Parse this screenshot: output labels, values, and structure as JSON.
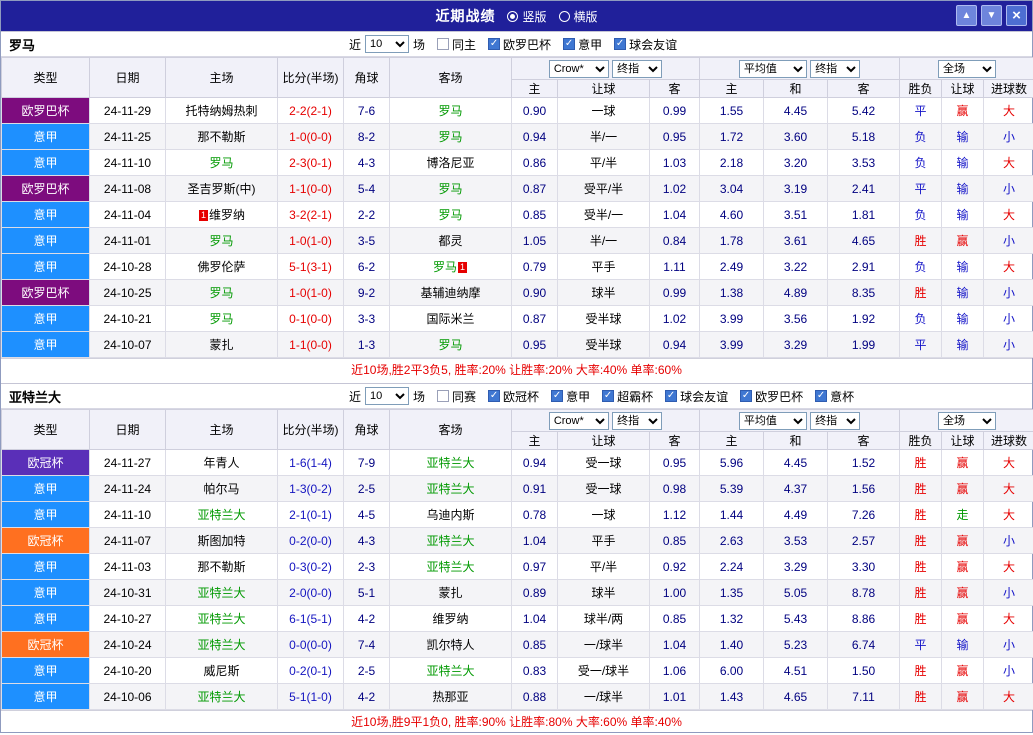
{
  "titlebar": {
    "title": "近期战绩",
    "radios": [
      {
        "label": "竖版",
        "selected": true
      },
      {
        "label": "横版",
        "selected": false
      }
    ],
    "buttons": {
      "up": "▲",
      "down": "▼",
      "close": "×"
    }
  },
  "columns": {
    "main": [
      "类型",
      "日期",
      "主场",
      "比分(半场)",
      "角球",
      "客场"
    ],
    "sub": [
      "主",
      "让球",
      "客",
      "主",
      "和",
      "客",
      "胜负",
      "让球",
      "进球数"
    ]
  },
  "colors": {
    "r": "#e60000",
    "b": "#1414c8",
    "g": "#009900"
  },
  "sections": [
    {
      "team": "罗马",
      "score_color": "#e60000",
      "filter": {
        "prefix": "近",
        "count": "10",
        "suffix": "场",
        "checkboxes": [
          {
            "label": "同主",
            "checked": false
          },
          {
            "label": "欧罗巴杯",
            "checked": true
          },
          {
            "label": "意甲",
            "checked": true
          },
          {
            "label": "球会友谊",
            "checked": true
          }
        ]
      },
      "selects": {
        "asia_company": "Crow*",
        "asia_time": "终指",
        "euro_company": "平均值",
        "euro_time": "终指",
        "scope": "全场"
      },
      "rows": [
        {
          "type": "欧罗巴杯",
          "type_color": "#7d0c7e",
          "date": "24-11-29",
          "home": "托特纳姆热刺",
          "home_focus": false,
          "home_badge": "",
          "score": "2-2(2-1)",
          "corner": "7-6",
          "away": "罗马",
          "away_focus": true,
          "away_badge": "",
          "asia": [
            "0.90",
            "一球",
            "0.99"
          ],
          "euro": [
            "1.55",
            "4.45",
            "5.42"
          ],
          "result": "平",
          "result_c": "b",
          "hcap": "赢",
          "hcap_c": "r",
          "goal": "大",
          "goal_c": "r"
        },
        {
          "type": "意甲",
          "type_color": "#1e90ff",
          "date": "24-11-25",
          "home": "那不勒斯",
          "home_focus": false,
          "home_badge": "",
          "score": "1-0(0-0)",
          "corner": "8-2",
          "away": "罗马",
          "away_focus": true,
          "away_badge": "",
          "asia": [
            "0.94",
            "半/一",
            "0.95"
          ],
          "euro": [
            "1.72",
            "3.60",
            "5.18"
          ],
          "result": "负",
          "result_c": "b",
          "hcap": "输",
          "hcap_c": "b",
          "goal": "小",
          "goal_c": "b"
        },
        {
          "type": "意甲",
          "type_color": "#1e90ff",
          "date": "24-11-10",
          "home": "罗马",
          "home_focus": true,
          "home_badge": "",
          "score": "2-3(0-1)",
          "corner": "4-3",
          "away": "博洛尼亚",
          "away_focus": false,
          "away_badge": "",
          "asia": [
            "0.86",
            "平/半",
            "1.03"
          ],
          "euro": [
            "2.18",
            "3.20",
            "3.53"
          ],
          "result": "负",
          "result_c": "b",
          "hcap": "输",
          "hcap_c": "b",
          "goal": "大",
          "goal_c": "r"
        },
        {
          "type": "欧罗巴杯",
          "type_color": "#7d0c7e",
          "date": "24-11-08",
          "home": "圣吉罗斯(中)",
          "home_focus": false,
          "home_badge": "",
          "score": "1-1(0-0)",
          "corner": "5-4",
          "away": "罗马",
          "away_focus": true,
          "away_badge": "",
          "asia": [
            "0.87",
            "受平/半",
            "1.02"
          ],
          "euro": [
            "3.04",
            "3.19",
            "2.41"
          ],
          "result": "平",
          "result_c": "b",
          "hcap": "输",
          "hcap_c": "b",
          "goal": "小",
          "goal_c": "b"
        },
        {
          "type": "意甲",
          "type_color": "#1e90ff",
          "date": "24-11-04",
          "home": "维罗纳",
          "home_focus": false,
          "home_badge": "1",
          "score": "3-2(2-1)",
          "corner": "2-2",
          "away": "罗马",
          "away_focus": true,
          "away_badge": "",
          "asia": [
            "0.85",
            "受半/一",
            "1.04"
          ],
          "euro": [
            "4.60",
            "3.51",
            "1.81"
          ],
          "result": "负",
          "result_c": "b",
          "hcap": "输",
          "hcap_c": "b",
          "goal": "大",
          "goal_c": "r"
        },
        {
          "type": "意甲",
          "type_color": "#1e90ff",
          "date": "24-11-01",
          "home": "罗马",
          "home_focus": true,
          "home_badge": "",
          "score": "1-0(1-0)",
          "corner": "3-5",
          "away": "都灵",
          "away_focus": false,
          "away_badge": "",
          "asia": [
            "1.05",
            "半/一",
            "0.84"
          ],
          "euro": [
            "1.78",
            "3.61",
            "4.65"
          ],
          "result": "胜",
          "result_c": "r",
          "hcap": "赢",
          "hcap_c": "r",
          "goal": "小",
          "goal_c": "b"
        },
        {
          "type": "意甲",
          "type_color": "#1e90ff",
          "date": "24-10-28",
          "home": "佛罗伦萨",
          "home_focus": false,
          "home_badge": "",
          "score": "5-1(3-1)",
          "corner": "6-2",
          "away": "罗马",
          "away_focus": true,
          "away_badge": "1",
          "asia": [
            "0.79",
            "平手",
            "1.11"
          ],
          "euro": [
            "2.49",
            "3.22",
            "2.91"
          ],
          "result": "负",
          "result_c": "b",
          "hcap": "输",
          "hcap_c": "b",
          "goal": "大",
          "goal_c": "r"
        },
        {
          "type": "欧罗巴杯",
          "type_color": "#7d0c7e",
          "date": "24-10-25",
          "home": "罗马",
          "home_focus": true,
          "home_badge": "",
          "score": "1-0(1-0)",
          "corner": "9-2",
          "away": "基辅迪纳摩",
          "away_focus": false,
          "away_badge": "",
          "asia": [
            "0.90",
            "球半",
            "0.99"
          ],
          "euro": [
            "1.38",
            "4.89",
            "8.35"
          ],
          "result": "胜",
          "result_c": "r",
          "hcap": "输",
          "hcap_c": "b",
          "goal": "小",
          "goal_c": "b"
        },
        {
          "type": "意甲",
          "type_color": "#1e90ff",
          "date": "24-10-21",
          "home": "罗马",
          "home_focus": true,
          "home_badge": "",
          "score": "0-1(0-0)",
          "corner": "3-3",
          "away": "国际米兰",
          "away_focus": false,
          "away_badge": "",
          "asia": [
            "0.87",
            "受半球",
            "1.02"
          ],
          "euro": [
            "3.99",
            "3.56",
            "1.92"
          ],
          "result": "负",
          "result_c": "b",
          "hcap": "输",
          "hcap_c": "b",
          "goal": "小",
          "goal_c": "b"
        },
        {
          "type": "意甲",
          "type_color": "#1e90ff",
          "date": "24-10-07",
          "home": "蒙扎",
          "home_focus": false,
          "home_badge": "",
          "score": "1-1(0-0)",
          "corner": "1-3",
          "away": "罗马",
          "away_focus": true,
          "away_badge": "",
          "asia": [
            "0.95",
            "受半球",
            "0.94"
          ],
          "euro": [
            "3.99",
            "3.29",
            "1.99"
          ],
          "result": "平",
          "result_c": "b",
          "hcap": "输",
          "hcap_c": "b",
          "goal": "小",
          "goal_c": "b"
        }
      ],
      "summary": "近10场,胜2平3负5, 胜率:20% 让胜率:20% 大率:40% 单率:60%"
    },
    {
      "team": "亚特兰大",
      "score_color": "#1414c0",
      "filter": {
        "prefix": "近",
        "count": "10",
        "suffix": "场",
        "checkboxes": [
          {
            "label": "同赛",
            "checked": false
          },
          {
            "label": "欧冠杯",
            "checked": true
          },
          {
            "label": "意甲",
            "checked": true
          },
          {
            "label": "超霸杯",
            "checked": true
          },
          {
            "label": "球会友谊",
            "checked": true
          },
          {
            "label": "欧罗巴杯",
            "checked": true
          },
          {
            "label": "意杯",
            "checked": true
          }
        ]
      },
      "selects": {
        "asia_company": "Crow*",
        "asia_time": "终指",
        "euro_company": "平均值",
        "euro_time": "终指",
        "scope": "全场"
      },
      "rows": [
        {
          "type": "欧冠杯",
          "type_color": "#5a2fb8",
          "date": "24-11-27",
          "home": "年青人",
          "home_focus": false,
          "home_badge": "",
          "score": "1-6(1-4)",
          "corner": "7-9",
          "away": "亚特兰大",
          "away_focus": true,
          "away_badge": "",
          "asia": [
            "0.94",
            "受一球",
            "0.95"
          ],
          "euro": [
            "5.96",
            "4.45",
            "1.52"
          ],
          "result": "胜",
          "result_c": "r",
          "hcap": "赢",
          "hcap_c": "r",
          "goal": "大",
          "goal_c": "r"
        },
        {
          "type": "意甲",
          "type_color": "#1e90ff",
          "date": "24-11-24",
          "home": "帕尔马",
          "home_focus": false,
          "home_badge": "",
          "score": "1-3(0-2)",
          "corner": "2-5",
          "away": "亚特兰大",
          "away_focus": true,
          "away_badge": "",
          "asia": [
            "0.91",
            "受一球",
            "0.98"
          ],
          "euro": [
            "5.39",
            "4.37",
            "1.56"
          ],
          "result": "胜",
          "result_c": "r",
          "hcap": "赢",
          "hcap_c": "r",
          "goal": "大",
          "goal_c": "r"
        },
        {
          "type": "意甲",
          "type_color": "#1e90ff",
          "date": "24-11-10",
          "home": "亚特兰大",
          "home_focus": true,
          "home_badge": "",
          "score": "2-1(0-1)",
          "corner": "4-5",
          "away": "乌迪内斯",
          "away_focus": false,
          "away_badge": "",
          "asia": [
            "0.78",
            "一球",
            "1.12"
          ],
          "euro": [
            "1.44",
            "4.49",
            "7.26"
          ],
          "result": "胜",
          "result_c": "r",
          "hcap": "走",
          "hcap_c": "g",
          "goal": "大",
          "goal_c": "r"
        },
        {
          "type": "欧冠杯",
          "type_color": "#ff7020",
          "date": "24-11-07",
          "home": "斯图加特",
          "home_focus": false,
          "home_badge": "",
          "score": "0-2(0-0)",
          "corner": "4-3",
          "away": "亚特兰大",
          "away_focus": true,
          "away_badge": "",
          "asia": [
            "1.04",
            "平手",
            "0.85"
          ],
          "euro": [
            "2.63",
            "3.53",
            "2.57"
          ],
          "result": "胜",
          "result_c": "r",
          "hcap": "赢",
          "hcap_c": "r",
          "goal": "小",
          "goal_c": "b"
        },
        {
          "type": "意甲",
          "type_color": "#1e90ff",
          "date": "24-11-03",
          "home": "那不勒斯",
          "home_focus": false,
          "home_badge": "",
          "score": "0-3(0-2)",
          "corner": "2-3",
          "away": "亚特兰大",
          "away_focus": true,
          "away_badge": "",
          "asia": [
            "0.97",
            "平/半",
            "0.92"
          ],
          "euro": [
            "2.24",
            "3.29",
            "3.30"
          ],
          "result": "胜",
          "result_c": "r",
          "hcap": "赢",
          "hcap_c": "r",
          "goal": "大",
          "goal_c": "r"
        },
        {
          "type": "意甲",
          "type_color": "#1e90ff",
          "date": "24-10-31",
          "home": "亚特兰大",
          "home_focus": true,
          "home_badge": "",
          "score": "2-0(0-0)",
          "corner": "5-1",
          "away": "蒙扎",
          "away_focus": false,
          "away_badge": "",
          "asia": [
            "0.89",
            "球半",
            "1.00"
          ],
          "euro": [
            "1.35",
            "5.05",
            "8.78"
          ],
          "result": "胜",
          "result_c": "r",
          "hcap": "赢",
          "hcap_c": "r",
          "goal": "小",
          "goal_c": "b"
        },
        {
          "type": "意甲",
          "type_color": "#1e90ff",
          "date": "24-10-27",
          "home": "亚特兰大",
          "home_focus": true,
          "home_badge": "",
          "score": "6-1(5-1)",
          "corner": "4-2",
          "away": "维罗纳",
          "away_focus": false,
          "away_badge": "",
          "asia": [
            "1.04",
            "球半/两",
            "0.85"
          ],
          "euro": [
            "1.32",
            "5.43",
            "8.86"
          ],
          "result": "胜",
          "result_c": "r",
          "hcap": "赢",
          "hcap_c": "r",
          "goal": "大",
          "goal_c": "r"
        },
        {
          "type": "欧冠杯",
          "type_color": "#ff7020",
          "date": "24-10-24",
          "home": "亚特兰大",
          "home_focus": true,
          "home_badge": "",
          "score": "0-0(0-0)",
          "corner": "7-4",
          "away": "凯尔特人",
          "away_focus": false,
          "away_badge": "",
          "asia": [
            "0.85",
            "一/球半",
            "1.04"
          ],
          "euro": [
            "1.40",
            "5.23",
            "6.74"
          ],
          "result": "平",
          "result_c": "b",
          "hcap": "输",
          "hcap_c": "b",
          "goal": "小",
          "goal_c": "b"
        },
        {
          "type": "意甲",
          "type_color": "#1e90ff",
          "date": "24-10-20",
          "home": "威尼斯",
          "home_focus": false,
          "home_badge": "",
          "score": "0-2(0-1)",
          "corner": "2-5",
          "away": "亚特兰大",
          "away_focus": true,
          "away_badge": "",
          "asia": [
            "0.83",
            "受一/球半",
            "1.06"
          ],
          "euro": [
            "6.00",
            "4.51",
            "1.50"
          ],
          "result": "胜",
          "result_c": "r",
          "hcap": "赢",
          "hcap_c": "r",
          "goal": "小",
          "goal_c": "b"
        },
        {
          "type": "意甲",
          "type_color": "#1e90ff",
          "date": "24-10-06",
          "home": "亚特兰大",
          "home_focus": true,
          "home_badge": "",
          "score": "5-1(1-0)",
          "corner": "4-2",
          "away": "热那亚",
          "away_focus": false,
          "away_badge": "",
          "asia": [
            "0.88",
            "一/球半",
            "1.01"
          ],
          "euro": [
            "1.43",
            "4.65",
            "7.11"
          ],
          "result": "胜",
          "result_c": "r",
          "hcap": "赢",
          "hcap_c": "r",
          "goal": "大",
          "goal_c": "r"
        }
      ],
      "summary": "近10场,胜9平1负0, 胜率:90% 让胜率:80% 大率:60% 单率:40%"
    }
  ]
}
